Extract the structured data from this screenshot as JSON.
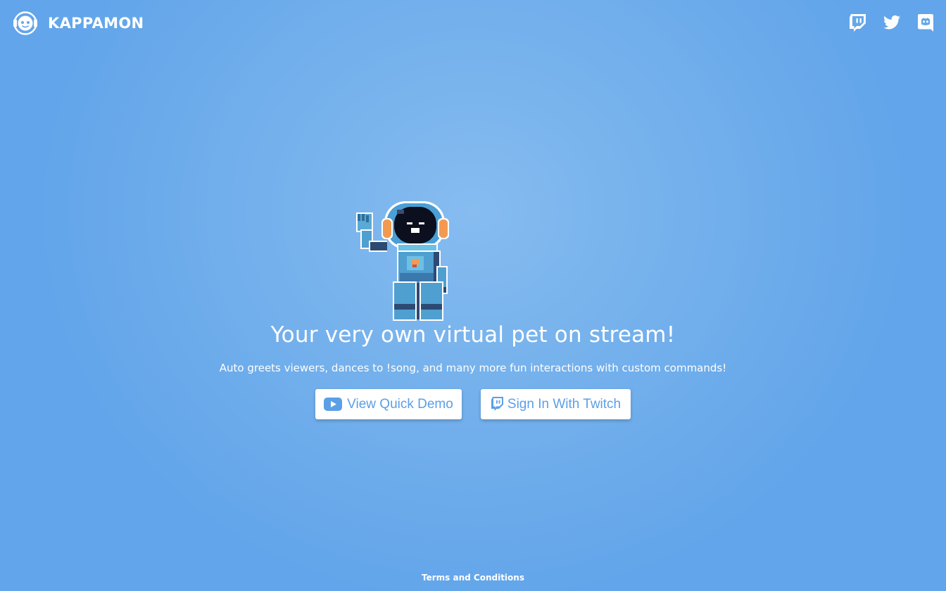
{
  "header": {
    "brand_name": "KAPPAMON",
    "logo_icon": "kappamon-logo",
    "social": [
      {
        "icon": "twitch-icon"
      },
      {
        "icon": "twitter-icon"
      },
      {
        "icon": "discord-icon"
      }
    ]
  },
  "hero": {
    "mascot": "waving-astronaut-pet",
    "headline": "Your very own virtual pet on stream!",
    "subtitle": "Auto greets viewers, dances to !song, and many more fun interactions with custom commands!",
    "buttons": {
      "demo_label": "View Quick Demo",
      "twitch_label": "Sign In With Twitch"
    }
  },
  "footer": {
    "terms_label": "Terms and Conditions"
  },
  "colors": {
    "background": "#64a7ea",
    "background_center": "#86bcf0",
    "button_text": "#5b9fe6",
    "youtube_icon": "#5b9fe6",
    "white": "#ffffff"
  }
}
